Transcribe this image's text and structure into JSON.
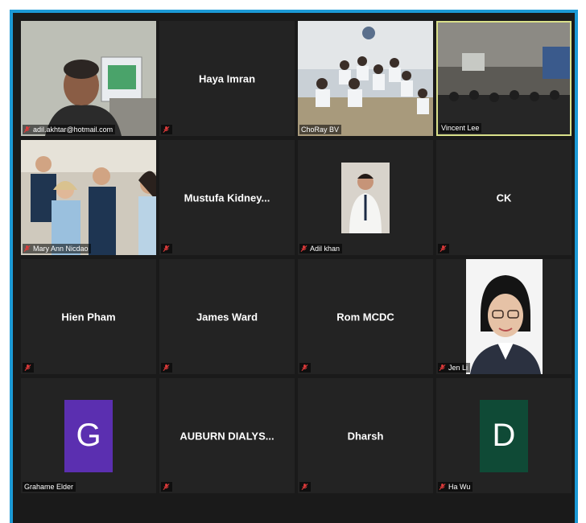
{
  "participants": [
    {
      "name": "Haya Imran"
    },
    {
      "name": "Mustufa  Kidney..."
    },
    {
      "name": "CK"
    },
    {
      "name": "Hien Pham"
    },
    {
      "name": "James Ward"
    },
    {
      "name": "Rom MCDC"
    },
    {
      "name": "AUBURN  DIALYS..."
    },
    {
      "name": "Dharsh"
    }
  ],
  "video_tiles": [
    {
      "label": "adil.akhtar@hotmail.com"
    },
    {
      "label": "ChoRay BV"
    },
    {
      "label": "Vincent Lee"
    },
    {
      "label": "Mary Ann Nicdao"
    },
    {
      "label": "Adil khan"
    },
    {
      "label": "Jen Li"
    }
  ],
  "avatar_tiles": [
    {
      "initial": "G",
      "label": "Grahame Elder",
      "color": "#5b2fb0"
    },
    {
      "initial": "D",
      "label": "Ha Wu",
      "color": "#0f4a36"
    }
  ],
  "colors": {
    "frame_border": "#1c9ad6",
    "tile_bg": "#232323",
    "active_speaker": "#d9e08a",
    "mic_muted": "#e03b3b"
  }
}
